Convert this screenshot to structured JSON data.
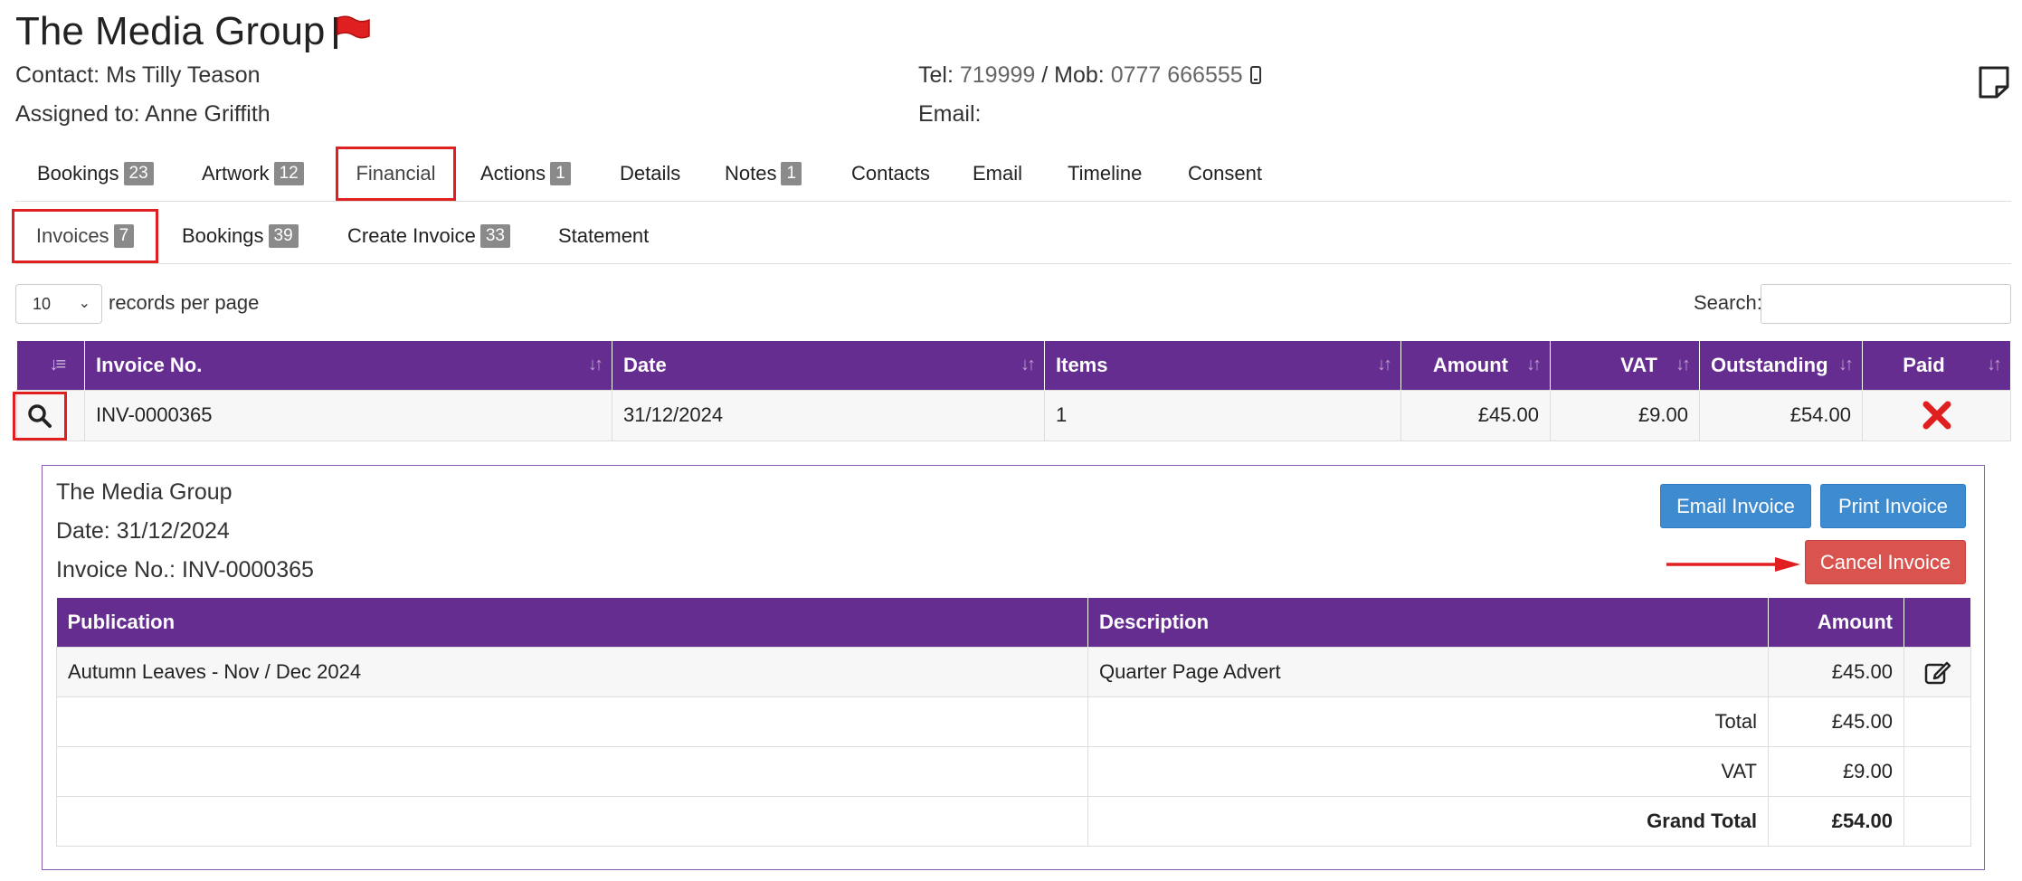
{
  "header": {
    "company": "The Media Group",
    "contact_label": "Contact:",
    "contact_name": "Ms Tilly Teason",
    "assigned_label": "Assigned to:",
    "assigned_name": "Anne Griffith",
    "tel_label": "Tel:",
    "tel": "719999",
    "mob_sep": "/ Mob:",
    "mob": "0777 666555",
    "email_label": "Email:",
    "email": "",
    "flag_color": "#e02020"
  },
  "tabs": [
    {
      "label": "Bookings",
      "badge": "23"
    },
    {
      "label": "Artwork",
      "badge": "12"
    },
    {
      "label": "Financial",
      "badge": ""
    },
    {
      "label": "Actions",
      "badge": "1"
    },
    {
      "label": "Details",
      "badge": ""
    },
    {
      "label": "Notes",
      "badge": "1"
    },
    {
      "label": "Contacts",
      "badge": ""
    },
    {
      "label": "Email",
      "badge": ""
    },
    {
      "label": "Timeline",
      "badge": ""
    },
    {
      "label": "Consent",
      "badge": ""
    }
  ],
  "subtabs": [
    {
      "label": "Invoices",
      "badge": "7"
    },
    {
      "label": "Bookings",
      "badge": "39"
    },
    {
      "label": "Create Invoice",
      "badge": "33"
    },
    {
      "label": "Statement",
      "badge": ""
    }
  ],
  "controls": {
    "page_size": "10",
    "records_label": "records per page",
    "search_label": "Search:"
  },
  "table": {
    "columns": [
      "Invoice No.",
      "Date",
      "Items",
      "Amount",
      "VAT",
      "Outstanding",
      "Paid"
    ],
    "rows": [
      {
        "invoice_no": "INV-0000365",
        "date": "31/12/2024",
        "items": "1",
        "amount": "£45.00",
        "vat": "£9.00",
        "outstanding": "£54.00",
        "paid": "no"
      }
    ]
  },
  "detail": {
    "company": "The Media Group",
    "date_line": "Date: 31/12/2024",
    "invoice_line": "Invoice No.: INV-0000365",
    "email_button": "Email Invoice",
    "print_button": "Print Invoice",
    "cancel_button": "Cancel Invoice",
    "columns": [
      "Publication",
      "Description",
      "Amount"
    ],
    "lines": [
      {
        "publication": "Autumn Leaves - Nov / Dec 2024",
        "description": "Quarter Page Advert",
        "amount": "£45.00"
      }
    ],
    "total_label": "Total",
    "total": "£45.00",
    "vat_label": "VAT",
    "vat": "£9.00",
    "grand_total_label": "Grand Total",
    "grand_total": "£54.00"
  },
  "colors": {
    "header_purple": "#652d90",
    "button_blue": "#3f8bd0",
    "button_red": "#d9534f",
    "highlight_red": "#e02020"
  }
}
